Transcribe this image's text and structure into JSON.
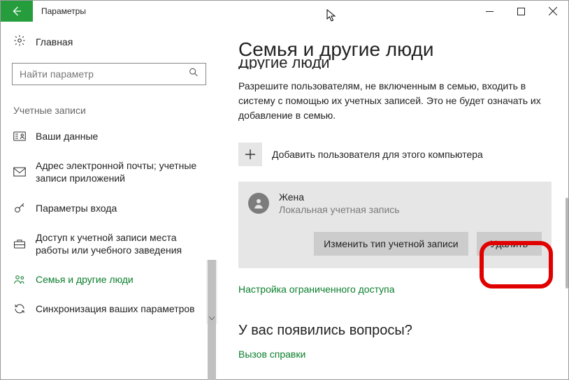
{
  "titlebar": {
    "title": "Параметры"
  },
  "sidebar": {
    "home": "Главная",
    "search_placeholder": "Найти параметр",
    "section": "Учетные записи",
    "items": [
      {
        "label": "Ваши данные"
      },
      {
        "label": "Адрес электронной почты; учетные записи приложений"
      },
      {
        "label": "Параметры входа"
      },
      {
        "label": "Доступ к учетной записи места работы или учебного заведения"
      },
      {
        "label": "Семья и другие люди"
      },
      {
        "label": "Синхронизация ваших параметров"
      }
    ]
  },
  "content": {
    "page_title": "Семья и другие люди",
    "cut_heading": "Другие люди",
    "desc": "Разрешите пользователям, не включенным в семью, входить в систему с помощью их учетных записей. Это не будет означать их добавление в семью.",
    "add_user": "Добавить пользователя для этого компьютера",
    "user": {
      "name": "Жена",
      "type": "Локальная учетная запись"
    },
    "btn_change": "Изменить тип учетной записи",
    "btn_delete": "Удалить",
    "link_assigned": "Настройка ограниченного доступа",
    "help_head": "У вас появились вопросы?",
    "help_link": "Вызов справки"
  }
}
